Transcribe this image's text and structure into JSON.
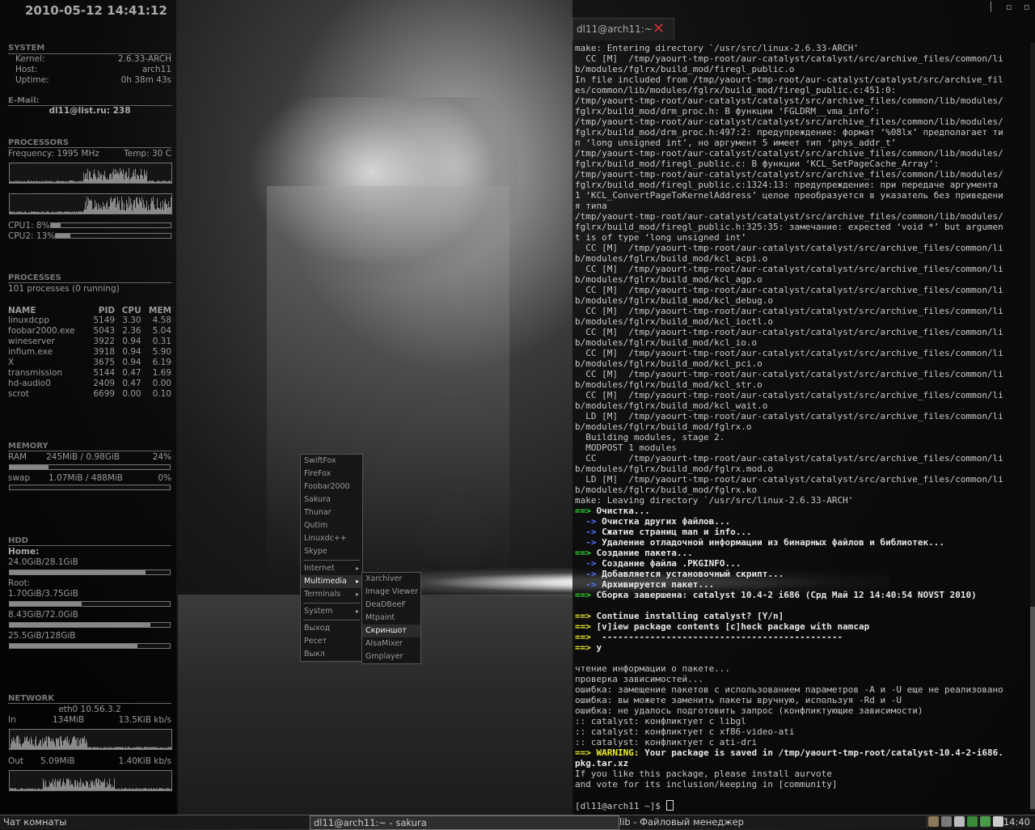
{
  "conky": {
    "datetime": "2010-05-12 14:41:12",
    "system": {
      "title": "SYSTEM",
      "kernel_label": "Kernel:",
      "kernel": "2.6.33-ARCH",
      "host_label": "Host:",
      "host": "arch11",
      "uptime_label": "Uptime:",
      "uptime": "0h 38m 43s"
    },
    "email": {
      "title": "E-Mail:",
      "value": "dl11@list.ru: 238"
    },
    "processors": {
      "title": "PROCESSORS",
      "frequency": "Frequency: 1995 MHz",
      "temp": "Temp: 30 C",
      "cpu1_label": "CPU1: 8%",
      "cpu1_level": 0.08,
      "cpu2_label": "CPU2: 13%",
      "cpu2_level": 0.13
    },
    "processes": {
      "title": "PROCESSES",
      "summary": "101 processes (0 running)",
      "headers": [
        "NAME",
        "PID",
        "CPU",
        "MEM"
      ],
      "rows": [
        [
          "linuxdcpp",
          "5149",
          "3.30",
          "4.58"
        ],
        [
          "foobar2000.exe",
          "5043",
          "2.36",
          "5.04"
        ],
        [
          "wineserver",
          "3922",
          "0.94",
          "0.31"
        ],
        [
          "infium.exe",
          "3918",
          "0.94",
          "5.90"
        ],
        [
          "X",
          "3675",
          "0.94",
          "6.19"
        ],
        [
          "transmission",
          "5144",
          "0.47",
          "1.69"
        ],
        [
          "hd-audio0",
          "2409",
          "0.47",
          "0.00"
        ],
        [
          "scrot",
          "6699",
          "0.00",
          "0.10"
        ]
      ]
    },
    "memory": {
      "title": "MEMORY",
      "ram_label": "RAM",
      "ram_value": "245MiB / 0.98GiB",
      "ram_pct": "24%",
      "ram_level": 0.24,
      "swap_label": "swap",
      "swap_value": "1.07MiB / 488MiB",
      "swap_pct": "0%",
      "swap_level": 0.0
    },
    "hdd": {
      "title": "HDD",
      "home_label": "Home:",
      "home_value": "24.0GiB/28.1GiB",
      "home_level": 0.85,
      "root_label": "Root:",
      "root_value": "1.70GiB/3.75GiB",
      "root_level": 0.45,
      "d3_value": "8.43GiB/72.0GiB",
      "d3_level": 0.88,
      "d4_value": "25.5GiB/128GiB",
      "d4_level": 0.8
    },
    "network": {
      "title": "NETWORK",
      "iface": "eth0 10.56.3.2",
      "in_label": "In",
      "in_total": "134MiB",
      "in_rate": "13.5KiB kb/s",
      "out_label": "Out",
      "out_total": "5.09MiB",
      "out_rate": "1.40KiB kb/s"
    }
  },
  "terminal": {
    "tab_title": "dl11@arch11:~",
    "lines": [
      "make: Entering directory `/usr/src/linux-2.6.33-ARCH'",
      "  CC [M]  /tmp/yaourt-tmp-root/aur-catalyst/catalyst/src/archive_files/common/li",
      "b/modules/fglrx/build_mod/firegl_public.o",
      "In file included from /tmp/yaourt-tmp-root/aur-catalyst/catalyst/src/archive_fil",
      "es/common/lib/modules/fglrx/build_mod/firegl_public.c:451:0:",
      "/tmp/yaourt-tmp-root/aur-catalyst/catalyst/src/archive_files/common/lib/modules/",
      "fglrx/build_mod/drm_proc.h: В функции ‘FGLDRM__vma_info’:",
      "/tmp/yaourt-tmp-root/aur-catalyst/catalyst/src/archive_files/common/lib/modules/",
      "fglrx/build_mod/drm_proc.h:497:2: предупреждение: формат ‘%08lx’ предполагает ти",
      "п ‘long unsigned int’, но аргумент 5 имеет тип ‘phys_addr_t’",
      "/tmp/yaourt-tmp-root/aur-catalyst/catalyst/src/archive_files/common/lib/modules/",
      "fglrx/build_mod/firegl_public.c: В функции ‘KCL_SetPageCache_Array’:",
      "/tmp/yaourt-tmp-root/aur-catalyst/catalyst/src/archive_files/common/lib/modules/",
      "fglrx/build_mod/firegl_public.c:1324:13: предупреждение: при передаче аргумента",
      "1 ‘KCL_ConvertPageToKernelAddress’ целое преобразуется в указатель без приведени",
      "я типа",
      "/tmp/yaourt-tmp-root/aur-catalyst/catalyst/src/archive_files/common/lib/modules/",
      "fglrx/build_mod/firegl_public.h:325:35: замечание: expected ‘void *’ but argumen",
      "t is of type ‘long unsigned int’",
      "  CC [M]  /tmp/yaourt-tmp-root/aur-catalyst/catalyst/src/archive_files/common/li",
      "b/modules/fglrx/build_mod/kcl_acpi.o",
      "  CC [M]  /tmp/yaourt-tmp-root/aur-catalyst/catalyst/src/archive_files/common/li",
      "b/modules/fglrx/build_mod/kcl_agp.o",
      "  CC [M]  /tmp/yaourt-tmp-root/aur-catalyst/catalyst/src/archive_files/common/li",
      "b/modules/fglrx/build_mod/kcl_debug.o",
      "  CC [M]  /tmp/yaourt-tmp-root/aur-catalyst/catalyst/src/archive_files/common/li",
      "b/modules/fglrx/build_mod/kcl_ioctl.o",
      "  CC [M]  /tmp/yaourt-tmp-root/aur-catalyst/catalyst/src/archive_files/common/li",
      "b/modules/fglrx/build_mod/kcl_io.o",
      "  CC [M]  /tmp/yaourt-tmp-root/aur-catalyst/catalyst/src/archive_files/common/li",
      "b/modules/fglrx/build_mod/kcl_pci.o",
      "  CC [M]  /tmp/yaourt-tmp-root/aur-catalyst/catalyst/src/archive_files/common/li",
      "b/modules/fglrx/build_mod/kcl_str.o",
      "  CC [M]  /tmp/yaourt-tmp-root/aur-catalyst/catalyst/src/archive_files/common/li",
      "b/modules/fglrx/build_mod/kcl_wait.o",
      "  LD [M]  /tmp/yaourt-tmp-root/aur-catalyst/catalyst/src/archive_files/common/li",
      "b/modules/fglrx/build_mod/fglrx.o",
      "  Building modules, stage 2.",
      "  MODPOST 1 modules",
      "  CC      /tmp/yaourt-tmp-root/aur-catalyst/catalyst/src/archive_files/common/li",
      "b/modules/fglrx/build_mod/fglrx.mod.o",
      "  LD [M]  /tmp/yaourt-tmp-root/aur-catalyst/catalyst/src/archive_files/common/li",
      "b/modules/fglrx/build_mod/fglrx.ko",
      "make: Leaving directory `/usr/src/linux-2.6.33-ARCH'"
    ],
    "styled_lines": [
      {
        "arrow": "==>",
        "arrow_color": "g",
        "text": "Очистка..."
      },
      {
        "arrow": "  ->",
        "arrow_color": "b",
        "text": "Очистка других файлов..."
      },
      {
        "arrow": "  ->",
        "arrow_color": "b",
        "text": "Сжатие страниц man и info..."
      },
      {
        "arrow": "  ->",
        "arrow_color": "b",
        "text": "Удаление отладочной информации из бинарных файлов и библиотек..."
      },
      {
        "arrow": "==>",
        "arrow_color": "g",
        "text": "Создание пакета..."
      },
      {
        "arrow": "  ->",
        "arrow_color": "b",
        "text": "Создание файла .PKGINFO..."
      },
      {
        "arrow": "  ->",
        "arrow_color": "b",
        "text": "Добавляется установочный скрипт..."
      },
      {
        "arrow": "  ->",
        "arrow_color": "b",
        "text": "Архивируется пакет..."
      },
      {
        "arrow": "==>",
        "arrow_color": "g",
        "text": "Сборка завершена: catalyst 10.4-2 i686 (Срд Май 12 14:40:54 NOVST 2010)"
      },
      {
        "arrow": "",
        "arrow_color": "",
        "text": ""
      },
      {
        "arrow": "==>",
        "arrow_color": "y",
        "text": "Continue installing catalyst? [Y/n]"
      },
      {
        "arrow": "==>",
        "arrow_color": "y",
        "text": "[v]iew package contents [c]heck package with namcap"
      },
      {
        "arrow": "==>",
        "arrow_color": "y",
        "text": " ---------------------------------------------"
      },
      {
        "arrow": "==>",
        "arrow_color": "y",
        "text": "y"
      }
    ],
    "tail_lines": [
      "",
      "чтение информации о пакете...",
      "проверка зависимостей...",
      "ошибка: замещение пакетов с использованием параметров -A и -U еще не реализовано",
      "ошибка: вы можете заменить пакеты вручную, используя -Rd и -U",
      "ошибка: не удалось подготовить запрос (конфликтующие зависимости)",
      ":: catalyst: конфликтует с libgl",
      ":: catalyst: конфликтует с xf86-video-ati",
      ":: catalyst: конфликтует с ati-dri"
    ],
    "warning_prefix": "==> WARNING:",
    "warning_text": " Your package is saved in /tmp/yaourt-tmp-root/catalyst-10.4-2-i686.",
    "warning_text2": "pkg.tar.xz",
    "after_lines": [
      "If you like this package, please install aurvote",
      "and vote for its inclusion/keeping in [community]",
      ""
    ],
    "prompt": "[dl11@arch11 ~]$ "
  },
  "menu_main": {
    "items_a": [
      "SwiftFox",
      "FireFox",
      "Foobar2000",
      "Sakura",
      "Thunar",
      "Qutim",
      "Linuxdc++",
      "Skype"
    ],
    "items_b": [
      "Internet",
      "Multimedia",
      "Terminals"
    ],
    "items_c": [
      "System"
    ],
    "items_d": [
      "Выход",
      "Ресет",
      "Выкл"
    ],
    "active": "Multimedia"
  },
  "menu_sub": {
    "items": [
      "Xarchiver",
      "Image Viewer",
      "DeaDBeeF",
      "Mtpaint",
      "Скриншот",
      "AlsaMixer",
      "Gmplayer"
    ],
    "active": "Скриншот"
  },
  "taskbar": {
    "tasks": [
      {
        "label": "Чат комнаты",
        "active": false
      },
      {
        "label": "dl11@arch11:~ - sakura",
        "active": true
      },
      {
        "label": "lib - Файловый менеджер",
        "active": false
      }
    ],
    "clock": "14:40"
  }
}
